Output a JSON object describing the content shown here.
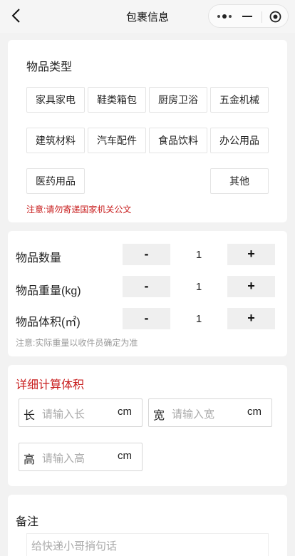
{
  "nav": {
    "title": "包裹信息"
  },
  "item_type": {
    "title": "物品类型",
    "types": [
      "家具家电",
      "鞋类箱包",
      "厨房卫浴",
      "五金机械",
      "建筑材料",
      "汽车配件",
      "食品饮料",
      "办公用品",
      "医药用品",
      "其他"
    ],
    "warning": "注意:请勿寄递国家机关公文"
  },
  "quantities": {
    "rows": [
      {
        "label": "物品数量",
        "minus": "-",
        "value": "1",
        "plus": "+"
      },
      {
        "label": "物品重量(kg)",
        "minus": "-",
        "value": "1",
        "plus": "+"
      },
      {
        "label": "物品体积(㎡)",
        "minus": "-",
        "value": "1",
        "plus": "+"
      }
    ],
    "note": "注意:实际重量以收件员确定为准"
  },
  "volume": {
    "title": "详细计算体积",
    "length": {
      "label": "长",
      "placeholder": "请输入长",
      "unit": "cm"
    },
    "width": {
      "label": "宽",
      "placeholder": "请输入宽",
      "unit": "cm"
    },
    "height": {
      "label": "高",
      "placeholder": "请输入高",
      "unit": "cm"
    }
  },
  "remark": {
    "title": "备注",
    "placeholder": "给快递小哥捎句话"
  }
}
